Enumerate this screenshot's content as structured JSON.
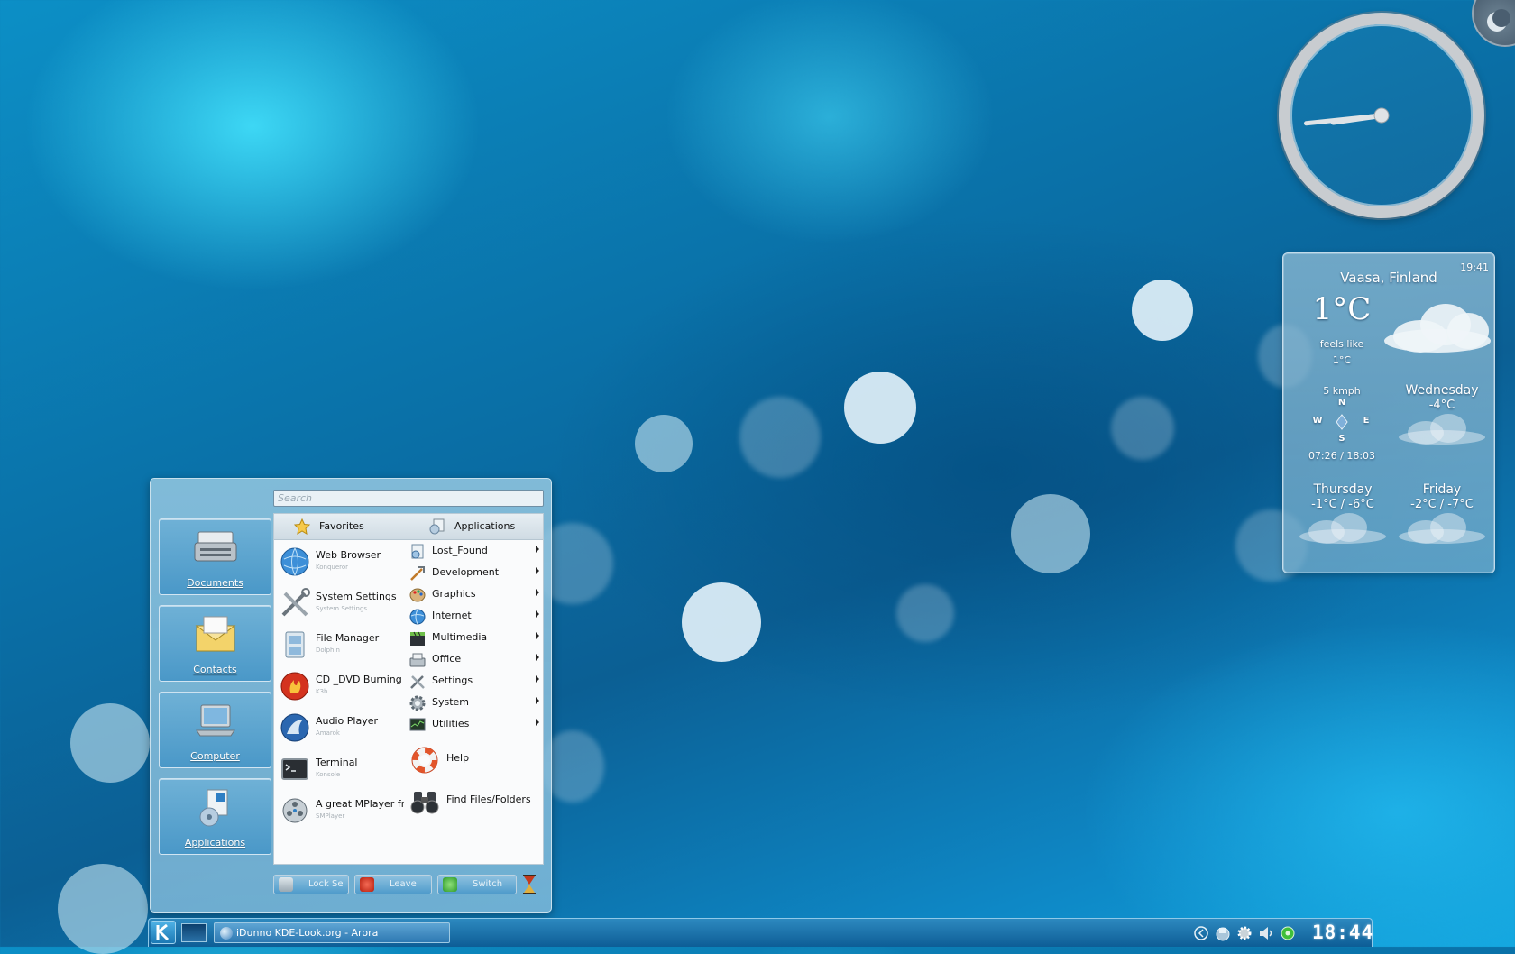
{
  "clock": {
    "hour": 8,
    "minute": 44
  },
  "weather": {
    "time": "19:41",
    "location": "Vaasa, Finland",
    "current_temp": "1°C",
    "feels_like_label": "feels like",
    "feels_like_value": "1°C",
    "wind": "5 kmph",
    "compass": {
      "n": "N",
      "w": "W",
      "e": "E",
      "s": "S"
    },
    "sun_times": "07:26 / 18:03",
    "forecast": [
      {
        "day": "Wednesday",
        "temp": "-4°C"
      },
      {
        "day": "Thursday",
        "temp": "-1°C / -6°C"
      },
      {
        "day": "Friday",
        "temp": "-2°C / -7°C"
      }
    ]
  },
  "menu": {
    "search_placeholder": "Search",
    "places": [
      {
        "label": "Documents"
      },
      {
        "label": "Contacts"
      },
      {
        "label": "Computer"
      },
      {
        "label": "Applications"
      }
    ],
    "tabs": {
      "favorites": "Favorites",
      "applications": "Applications"
    },
    "favorites": [
      {
        "name": "Web Browser",
        "sub": "Konqueror"
      },
      {
        "name": "System Settings",
        "sub": "System Settings"
      },
      {
        "name": "File Manager",
        "sub": "Dolphin"
      },
      {
        "name": "CD _DVD Burning",
        "sub": "K3b"
      },
      {
        "name": "Audio Player",
        "sub": "Amarok"
      },
      {
        "name": "Terminal",
        "sub": "Konsole"
      },
      {
        "name": "A great MPlayer fr",
        "sub": "SMPlayer"
      }
    ],
    "categories": [
      {
        "name": "Lost_Found"
      },
      {
        "name": "Development"
      },
      {
        "name": "Graphics"
      },
      {
        "name": "Internet"
      },
      {
        "name": "Multimedia"
      },
      {
        "name": "Office"
      },
      {
        "name": "Settings"
      },
      {
        "name": "System"
      },
      {
        "name": "Utilities"
      }
    ],
    "extra": [
      {
        "name": "Help"
      },
      {
        "name": "Find Files/Folders"
      }
    ],
    "buttons": {
      "lock": "Lock Se",
      "leave": "Leave",
      "switch": "Switch"
    }
  },
  "taskbar": {
    "task": "iDunno KDE-Look.org - Arora",
    "time": "18:44"
  }
}
